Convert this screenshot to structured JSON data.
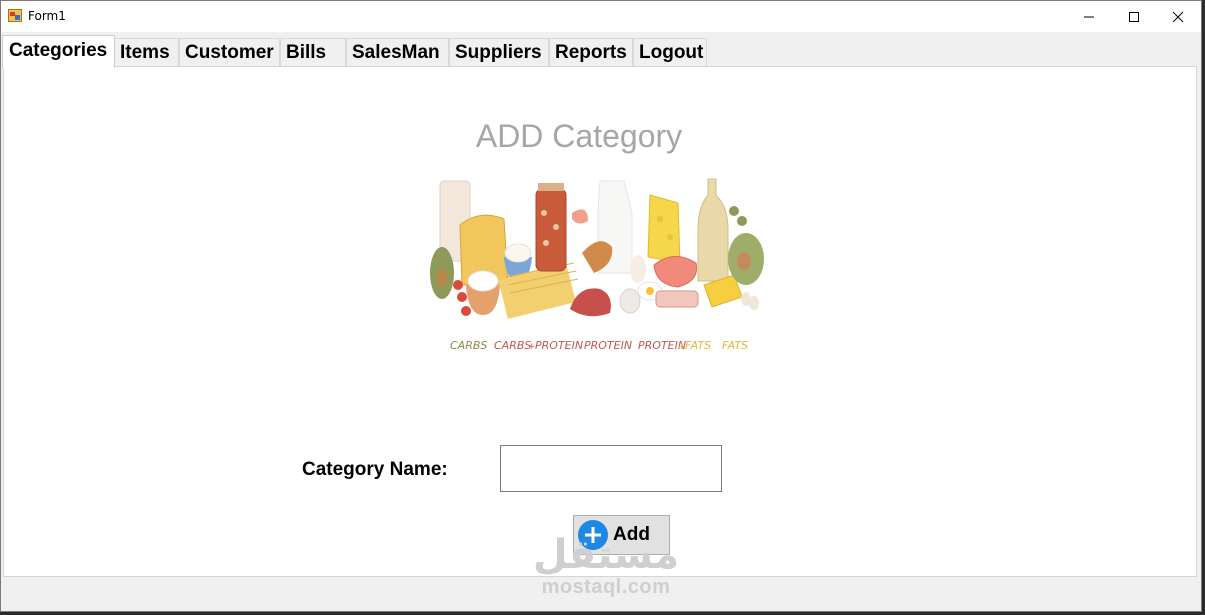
{
  "window": {
    "title": "Form1",
    "controls": {
      "minimize_icon": "minimize-icon",
      "maximize_icon": "maximize-icon",
      "close_icon": "close-icon"
    }
  },
  "tabs": [
    {
      "label": "Categories",
      "active": true
    },
    {
      "label": "Items",
      "active": false
    },
    {
      "label": "Customer",
      "active": false
    },
    {
      "label": "Bills",
      "active": false
    },
    {
      "label": "SalesMan",
      "active": false
    },
    {
      "label": "Suppliers",
      "active": false
    },
    {
      "label": "Reports",
      "active": false
    },
    {
      "label": "Logout",
      "active": false
    }
  ],
  "main": {
    "heading": "ADD Category",
    "illustration_captions": {
      "c1": "CARBS",
      "c2a": "CARBS",
      "c2b": "+",
      "c2c": "PROTEIN",
      "c3": "PROTEIN",
      "c4a": "PROTEIN",
      "c4b": "+",
      "c4c": "FATS",
      "c5": "FATS"
    },
    "category_label": "Category Name:",
    "category_input": {
      "value": "",
      "placeholder": ""
    },
    "add_button": {
      "label": "Add",
      "icon": "plus-circle-icon"
    }
  },
  "watermark": {
    "arabic": "مستقل",
    "latin": "mostaql.com"
  },
  "colors": {
    "heading": "#a6a6a6",
    "add_icon": "#1e88e5",
    "caption_red": "#c0584f",
    "caption_olive": "#8a8a4a",
    "caption_gold": "#e5b43a"
  }
}
